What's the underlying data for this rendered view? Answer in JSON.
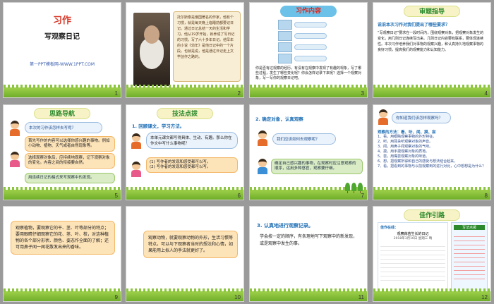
{
  "slides": [
    {
      "num": "1",
      "title": "习作",
      "subtitle": "写观察日记",
      "footer": "第一PPT模板网-WWW.1PPT.COM"
    },
    {
      "num": "2",
      "text": "托尔斯泰是俄国著名的作家，他有个习惯，就是每天晚上临睡前都要记日记。通过日记总结一天的生活和学习。他从19岁开始，就养成了写日记的习惯，写了六十多年日记。他早年的小说《幼年》是他日记中的一个片段。也就是说，他是通过日记走上文学创作之路的。"
    },
    {
      "num": "3",
      "banner": "习作内容",
      "items": [
        "",
        "",
        "",
        ""
      ],
      "text": "你是否有过观察的经历，有没有在观察中发现了有趣的现象，写了哪些过程，发生了哪些变化呢？你会怎样记录下来呢？选择一个观察对象，写一写你的观察日记吧。"
    },
    {
      "num": "4",
      "banner": "审题指导",
      "question": "说说本次习作对我们提出了哪些要求？",
      "text": "“写观察日记”要求在一段时间内，围绕观察对象，把观察对象发生的变化，用几则日记连续写出来。几则日记内容要有联系，要体现连续性。本次习作培养我们对事物的观察兴趣，和认真持久地观察事物的良好习惯，提高我们的观察能力和认知能力。"
    },
    {
      "num": "5",
      "banner": "思路导航",
      "bubble": "本次的习作该怎样去写呢？",
      "tips": [
        "首先写作的内容可以选择你感兴趣的事物。例如小动物、植物、天气或者自然现象等。",
        "选择观察对象后，应持续地观察，记下观察对象的变化。内容之间的衔接要自然。",
        "用连续日记的格式来写观察中的发现。"
      ]
    },
    {
      "num": "6",
      "banner": "技法点拨",
      "heading": "1. 回顾课文，学习方法。",
      "text": "本单元课文都写得具体、生动、有趣。那么你在作文中写什么事物呢？",
      "points": [
        "(1) 写作者的发现和感受都可以写。",
        "(2) 写作者的发现和感受都可以写。"
      ]
    },
    {
      "num": "7",
      "heading": "2. 确定对象，认真观察",
      "bubble": "我们应该如何去观察呢？",
      "text": "确定自己感兴趣的事物，在观察时应注意观察的顺序，运用多种感官，观察要仔细。"
    },
    {
      "num": "8",
      "question": "你知道我们该怎样观察吗？",
      "senses": "观察的方法：看、听、闻、摸、尝",
      "lines": [
        "1、看，用眼睛观察事物的外形特征。",
        "2、听，用耳朵听观察对象的声音。",
        "3、闻，用鼻子闻观察对象的气味。",
        "4、摸，用手摸观察对象的质地。",
        "5、尝，用嘴尝观察对象的味道。",
        "6、想，把观察所得和自己的感受与想法结合起来。",
        "7、看，把看到的事物与以前观察到的进行对比，心中想想是为什么？"
      ]
    },
    {
      "num": "9",
      "text": "观察植物，要观察它的干、茎、叶等部分的特点；要用眼睛仔细观察它的花、茎、叶、枝，对这种植物的各个部分形状、颜色、姿态作全面的了解；还可用鼻子闻一闻花散发出来的香味。"
    },
    {
      "num": "10",
      "text": "观察动物，就要观察动物的外形，生活习惯等特点。可以与下观察者当时的想法和心情，如果能用上拟人的手法就更好了。"
    },
    {
      "num": "11",
      "heading": "3. 认真地进行观察记录。",
      "text": "学会按一定的顺序，有条理地写下观察中的新发现，或是观察中发生的事。"
    },
    {
      "num": "12",
      "banner": "佳作引路",
      "doc_title": "佳作在线：",
      "side_title": "写法点拨",
      "diary_head": "观察蒜苗生长的日记",
      "date": "2018年3月16日  星期三  晴"
    }
  ]
}
